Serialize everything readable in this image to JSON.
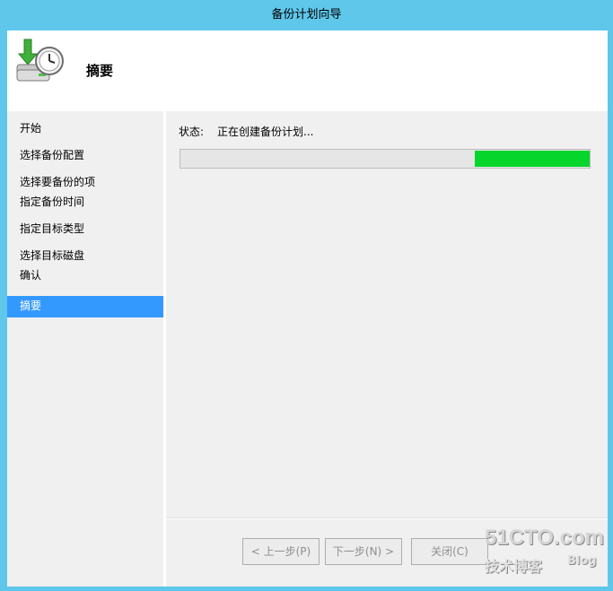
{
  "window": {
    "title": "备份计划向导"
  },
  "header": {
    "title": "摘要",
    "icon": "backup-clock-icon"
  },
  "sidebar": {
    "items": [
      {
        "label": "开始"
      },
      {
        "label": "选择备份配置"
      },
      {
        "label": "选择要备份的项"
      },
      {
        "label": "指定备份时间"
      },
      {
        "label": "指定目标类型"
      },
      {
        "label": "选择目标磁盘"
      },
      {
        "label": "确认"
      },
      {
        "label": "摘要",
        "active": true
      }
    ]
  },
  "main": {
    "status_label": "状态:",
    "status_value": "正在创建备份计划...",
    "progress": {
      "start_fraction": 0.72,
      "end_fraction": 1.0,
      "color": "#06d52c"
    }
  },
  "buttons": {
    "previous": "< 上一步(P)",
    "next": "下一步(N) >",
    "close": "关闭(C)"
  },
  "watermark": {
    "brand": "51CTO.com",
    "sub": "技术博客",
    "blog": "Blog"
  },
  "colors": {
    "titlebar": "#5ec7ea",
    "active_item": "#3399ff",
    "progress": "#06d52c"
  }
}
